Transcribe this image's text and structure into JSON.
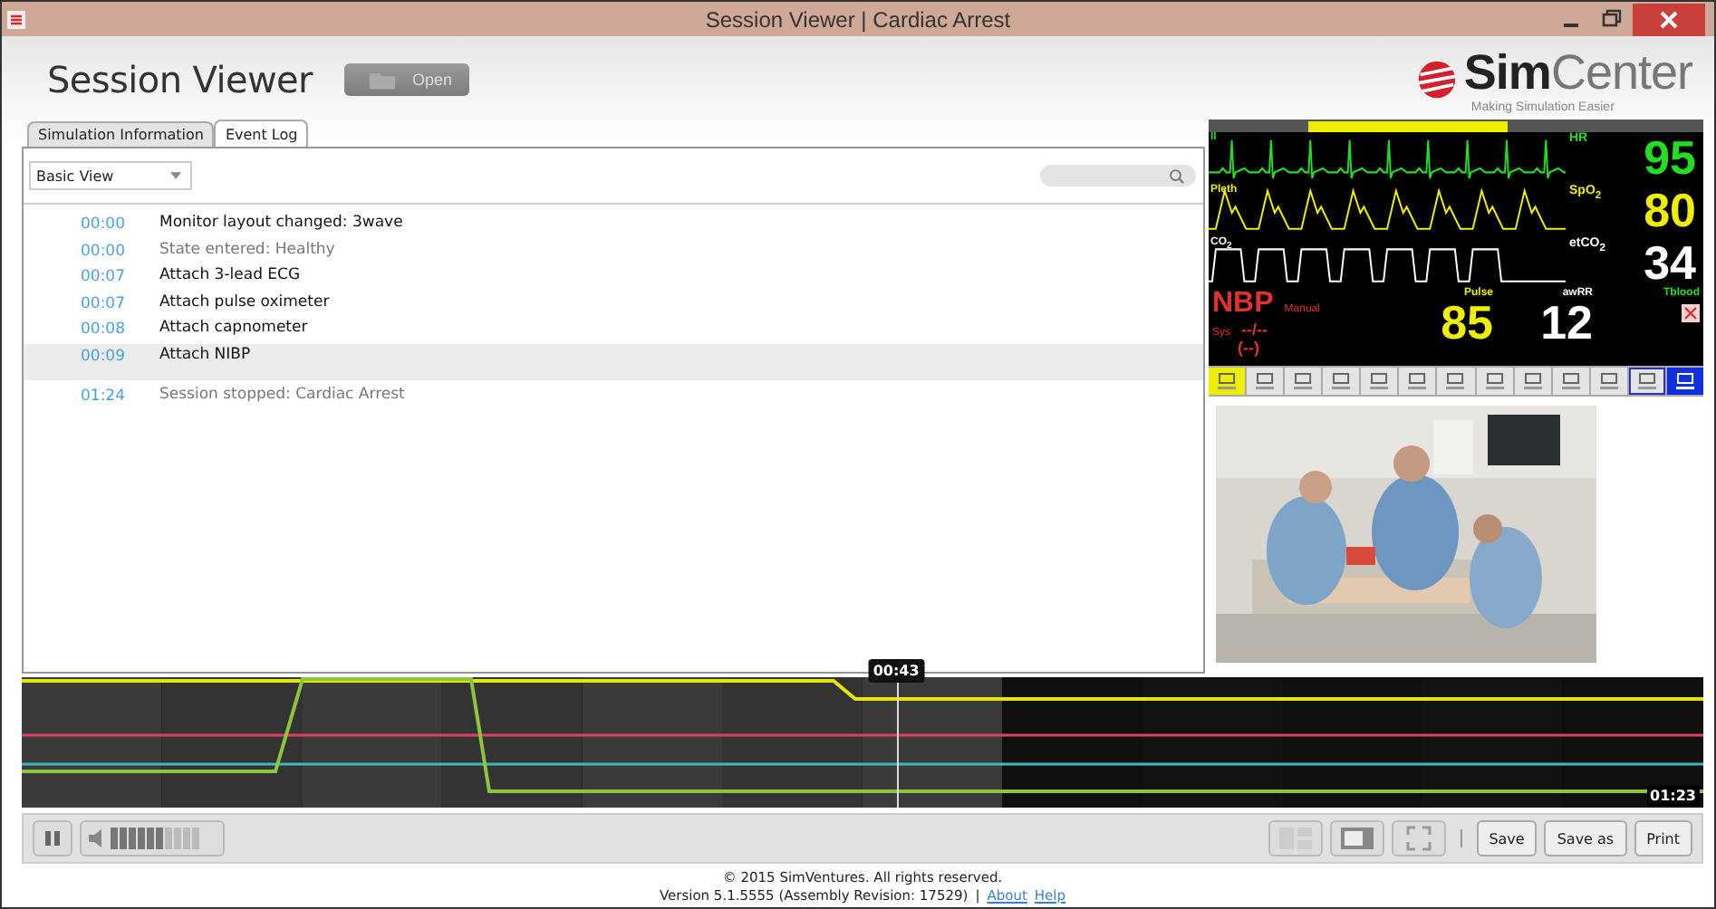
{
  "window": {
    "title": "Session Viewer | Cardiac Arrest"
  },
  "header": {
    "title": "Session Viewer",
    "open_button": "Open",
    "logo": {
      "name_bold": "Sim",
      "name_light": "Center",
      "tagline": "Making Simulation Easier"
    }
  },
  "tabs": [
    {
      "label": "Simulation Information",
      "selected": false
    },
    {
      "label": "Event Log",
      "selected": true
    }
  ],
  "event_log": {
    "view_select": "Basic View",
    "rows": [
      {
        "time": "00:00",
        "text": "Monitor layout changed: 3wave",
        "kind": "action",
        "selected": false
      },
      {
        "time": "00:00",
        "text": "State entered: Healthy",
        "kind": "state",
        "selected": false
      },
      {
        "time": "00:07",
        "text": "Attach 3-lead ECG",
        "kind": "action",
        "selected": false
      },
      {
        "time": "00:07",
        "text": "Attach pulse oximeter",
        "kind": "action",
        "selected": false
      },
      {
        "time": "00:08",
        "text": "Attach capnometer",
        "kind": "action",
        "selected": false
      },
      {
        "time": "00:09",
        "text": "Attach NIBP",
        "kind": "action",
        "selected": true
      },
      {
        "time": "01:24",
        "text": "Session stopped: Cardiac Arrest",
        "kind": "state",
        "selected": false
      }
    ]
  },
  "monitor": {
    "waves": [
      {
        "label": "II",
        "kind": "ecg",
        "param": "HR",
        "value": "95",
        "color": "#22dd22"
      },
      {
        "label": "Pleth",
        "kind": "pleth",
        "param": "SpO$_{2}$",
        "value": "80",
        "color": "#eeee00"
      },
      {
        "label": "CO$_{2}$",
        "kind": "co2",
        "param": "etCO$_{2}$",
        "value": "34",
        "color": "#ffffff"
      }
    ],
    "nbp": {
      "label": "NBP",
      "mode": "Manual",
      "sys": "Sys",
      "reading": "--/--",
      "mean": "(--)"
    },
    "pulse": {
      "label": "Pulse",
      "value": "85"
    },
    "awrr": {
      "label": "awRR",
      "value": "12"
    },
    "tblood": {
      "label": "Tblood"
    }
  },
  "timeline": {
    "playhead": {
      "label": "00:43",
      "level": 0.52
    },
    "end_label": "01:23"
  },
  "controls": {
    "volume": {
      "level": 0.55
    },
    "buttons": [
      "Save",
      "Save as",
      "Print"
    ]
  },
  "footer": {
    "copyright": "© 2015 SimVentures. All rights reserved.",
    "version": "Version 5.1.5555 (Assembly Revision: 17529)",
    "separator": "|",
    "links": [
      "About",
      "Help"
    ]
  }
}
